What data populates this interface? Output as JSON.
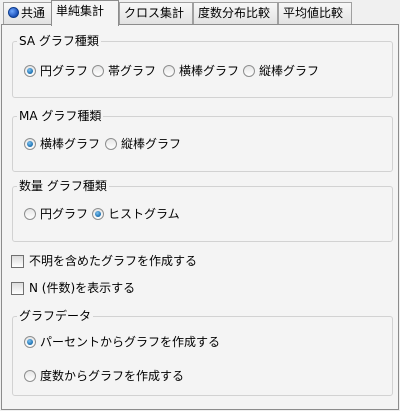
{
  "tabs": [
    {
      "label": "共通"
    },
    {
      "label": "単純集計"
    },
    {
      "label": "クロス集計"
    },
    {
      "label": "度数分布比較"
    },
    {
      "label": "平均値比較"
    }
  ],
  "sa_group": {
    "title": "SA グラフ種類",
    "options": [
      "円グラフ",
      "帯グラフ",
      "横棒グラフ",
      "縦棒グラフ"
    ],
    "selected": "円グラフ"
  },
  "ma_group": {
    "title": "MA グラフ種類",
    "options": [
      "横棒グラフ",
      "縦棒グラフ"
    ],
    "selected": "横棒グラフ"
  },
  "quantity_group": {
    "title": "数量 グラフ種類",
    "options": [
      "円グラフ",
      "ヒストグラム"
    ],
    "selected": "ヒストグラム"
  },
  "checkboxes": {
    "include_unknown": {
      "label": "不明を含めたグラフを作成する",
      "checked": false
    },
    "show_n": {
      "label": "N (件数)を表示する",
      "checked": false
    }
  },
  "graph_data_group": {
    "title": "グラフデータ",
    "options": [
      "パーセントからグラフを作成する",
      "度数からグラフを作成する"
    ],
    "selected": "パーセントからグラフを作成する"
  }
}
